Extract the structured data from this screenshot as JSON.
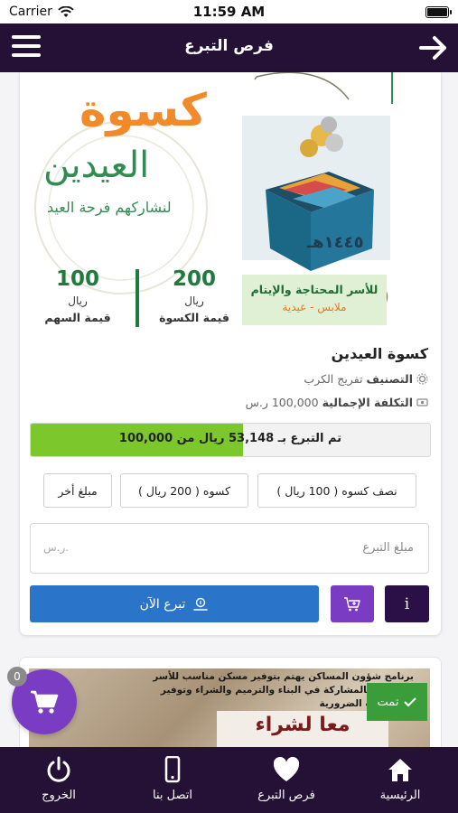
{
  "status_bar": {
    "carrier": "Carrier",
    "time": "11:59 AM"
  },
  "navbar": {
    "title": "فرص التبرع"
  },
  "banner": {
    "title_orange": "كسوة",
    "title_green": "العيدين",
    "subtitle": "لنشاركهم فرحة العيد",
    "year": "١٤٤٥هـ",
    "stats": [
      {
        "value": "100",
        "unit": "ريال",
        "label": "قيمة السهم"
      },
      {
        "value": "200",
        "unit": "ريال",
        "label": "قيمة الكسوة"
      }
    ],
    "target_line1": "للأسر المحتاجة والإيتام",
    "target_line2": "ملابس - عيدية"
  },
  "project": {
    "title": "كسوة العيدين",
    "category_label": "التصنيف",
    "category_value": "تفريج الكرب",
    "total_label": "التكلفة الإجمالية",
    "total_value": "100,000 ر.س"
  },
  "progress": {
    "fraction": 0.53148,
    "text": "تم التبرع بـ 53,148 ريال من 100,000"
  },
  "amount_options": [
    "نصف كسوه ( 100 ريال )",
    "كسوه ( 200 ريال )",
    "مبلغ أخر"
  ],
  "donation_input": {
    "placeholder": "مبلغ التبرع",
    "currency": "ر.س."
  },
  "actions": {
    "donate_now": "تبرع الآن",
    "info": "i"
  },
  "second_card": {
    "text": "برنامج شؤون المساكن يهتم بتوفير مسكن مناسب للأسر المحتاجة بالمشاركة في البناء والترميم والشراء وتوفير الاحتياجات الضرورية",
    "headline": "معا لشراء",
    "done_badge": "تمت"
  },
  "cart": {
    "count": "0"
  },
  "tabbar": [
    {
      "label": "الرئيسية",
      "icon": "home-icon"
    },
    {
      "label": "فرص التبرع",
      "icon": "heart-icon"
    },
    {
      "label": "اتصل بنا",
      "icon": "phone-icon"
    },
    {
      "label": "الخروج",
      "icon": "power-icon"
    }
  ],
  "colors": {
    "header": "#251135",
    "purple": "#7b3cc4",
    "blue": "#2a75c9",
    "green": "#7cc72b"
  }
}
